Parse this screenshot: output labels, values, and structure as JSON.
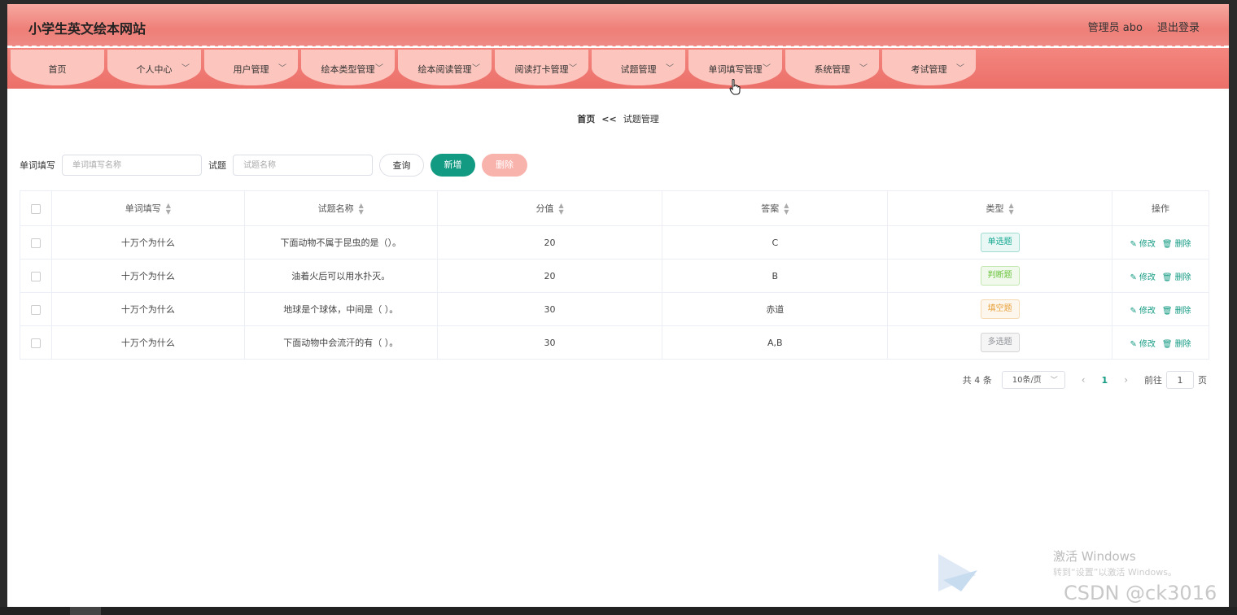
{
  "header": {
    "site_title": "小学生英文绘本网站",
    "user_label": "管理员 abo",
    "logout_label": "退出登录"
  },
  "nav": [
    {
      "label": "首页",
      "has_dropdown": false
    },
    {
      "label": "个人中心",
      "has_dropdown": true
    },
    {
      "label": "用户管理",
      "has_dropdown": true
    },
    {
      "label": "绘本类型管理",
      "has_dropdown": true
    },
    {
      "label": "绘本阅读管理",
      "has_dropdown": true
    },
    {
      "label": "阅读打卡管理",
      "has_dropdown": true
    },
    {
      "label": "试题管理",
      "has_dropdown": true
    },
    {
      "label": "单词填写管理",
      "has_dropdown": true
    },
    {
      "label": "系统管理",
      "has_dropdown": true
    },
    {
      "label": "考试管理",
      "has_dropdown": true
    }
  ],
  "breadcrumb": {
    "home": "首页",
    "separator": "<<",
    "current": "试题管理"
  },
  "search": {
    "word_label": "单词填写",
    "word_placeholder": "单词填写名称",
    "question_label": "试题",
    "question_placeholder": "试题名称",
    "query_button": "查询",
    "add_button": "新增",
    "delete_button": "删除"
  },
  "table": {
    "headers": [
      "单词填写",
      "试题名称",
      "分值",
      "答案",
      "类型",
      "操作"
    ],
    "rows": [
      {
        "word": "十万个为什么",
        "question": "下面动物不属于昆虫的是（）。",
        "score": "20",
        "answer": "C",
        "type": "单选题",
        "type_color": "#13a891"
      },
      {
        "word": "十万个为什么",
        "question": "油着火后可以用水扑灭。",
        "score": "20",
        "answer": "B",
        "type": "判断题",
        "type_color": "#67c23a"
      },
      {
        "word": "十万个为什么",
        "question": "地球是个球体，中间是（ ）。",
        "score": "30",
        "answer": "赤道",
        "type": "填空题",
        "type_color": "#e6a23c"
      },
      {
        "word": "十万个为什么",
        "question": "下面动物中会流汗的有（ ）。",
        "score": "30",
        "answer": "A,B",
        "type": "多选题",
        "type_color": "#909399"
      }
    ],
    "edit_label": "修改",
    "delete_label": "删除"
  },
  "pagination": {
    "total": "共 4 条",
    "page_size": "10条/页",
    "current_page": "1",
    "goto_prefix": "前往",
    "goto_value": "1",
    "goto_suffix": "页"
  },
  "watermark": {
    "activate_line1": "激活 Windows",
    "activate_line2": "转到“设置”以激活 Windows。",
    "csdn": "CSDN @ck3016"
  },
  "colors": {
    "primary": "#129a82",
    "header": "#ee7f78",
    "nav_tab": "#fcc5bd"
  }
}
